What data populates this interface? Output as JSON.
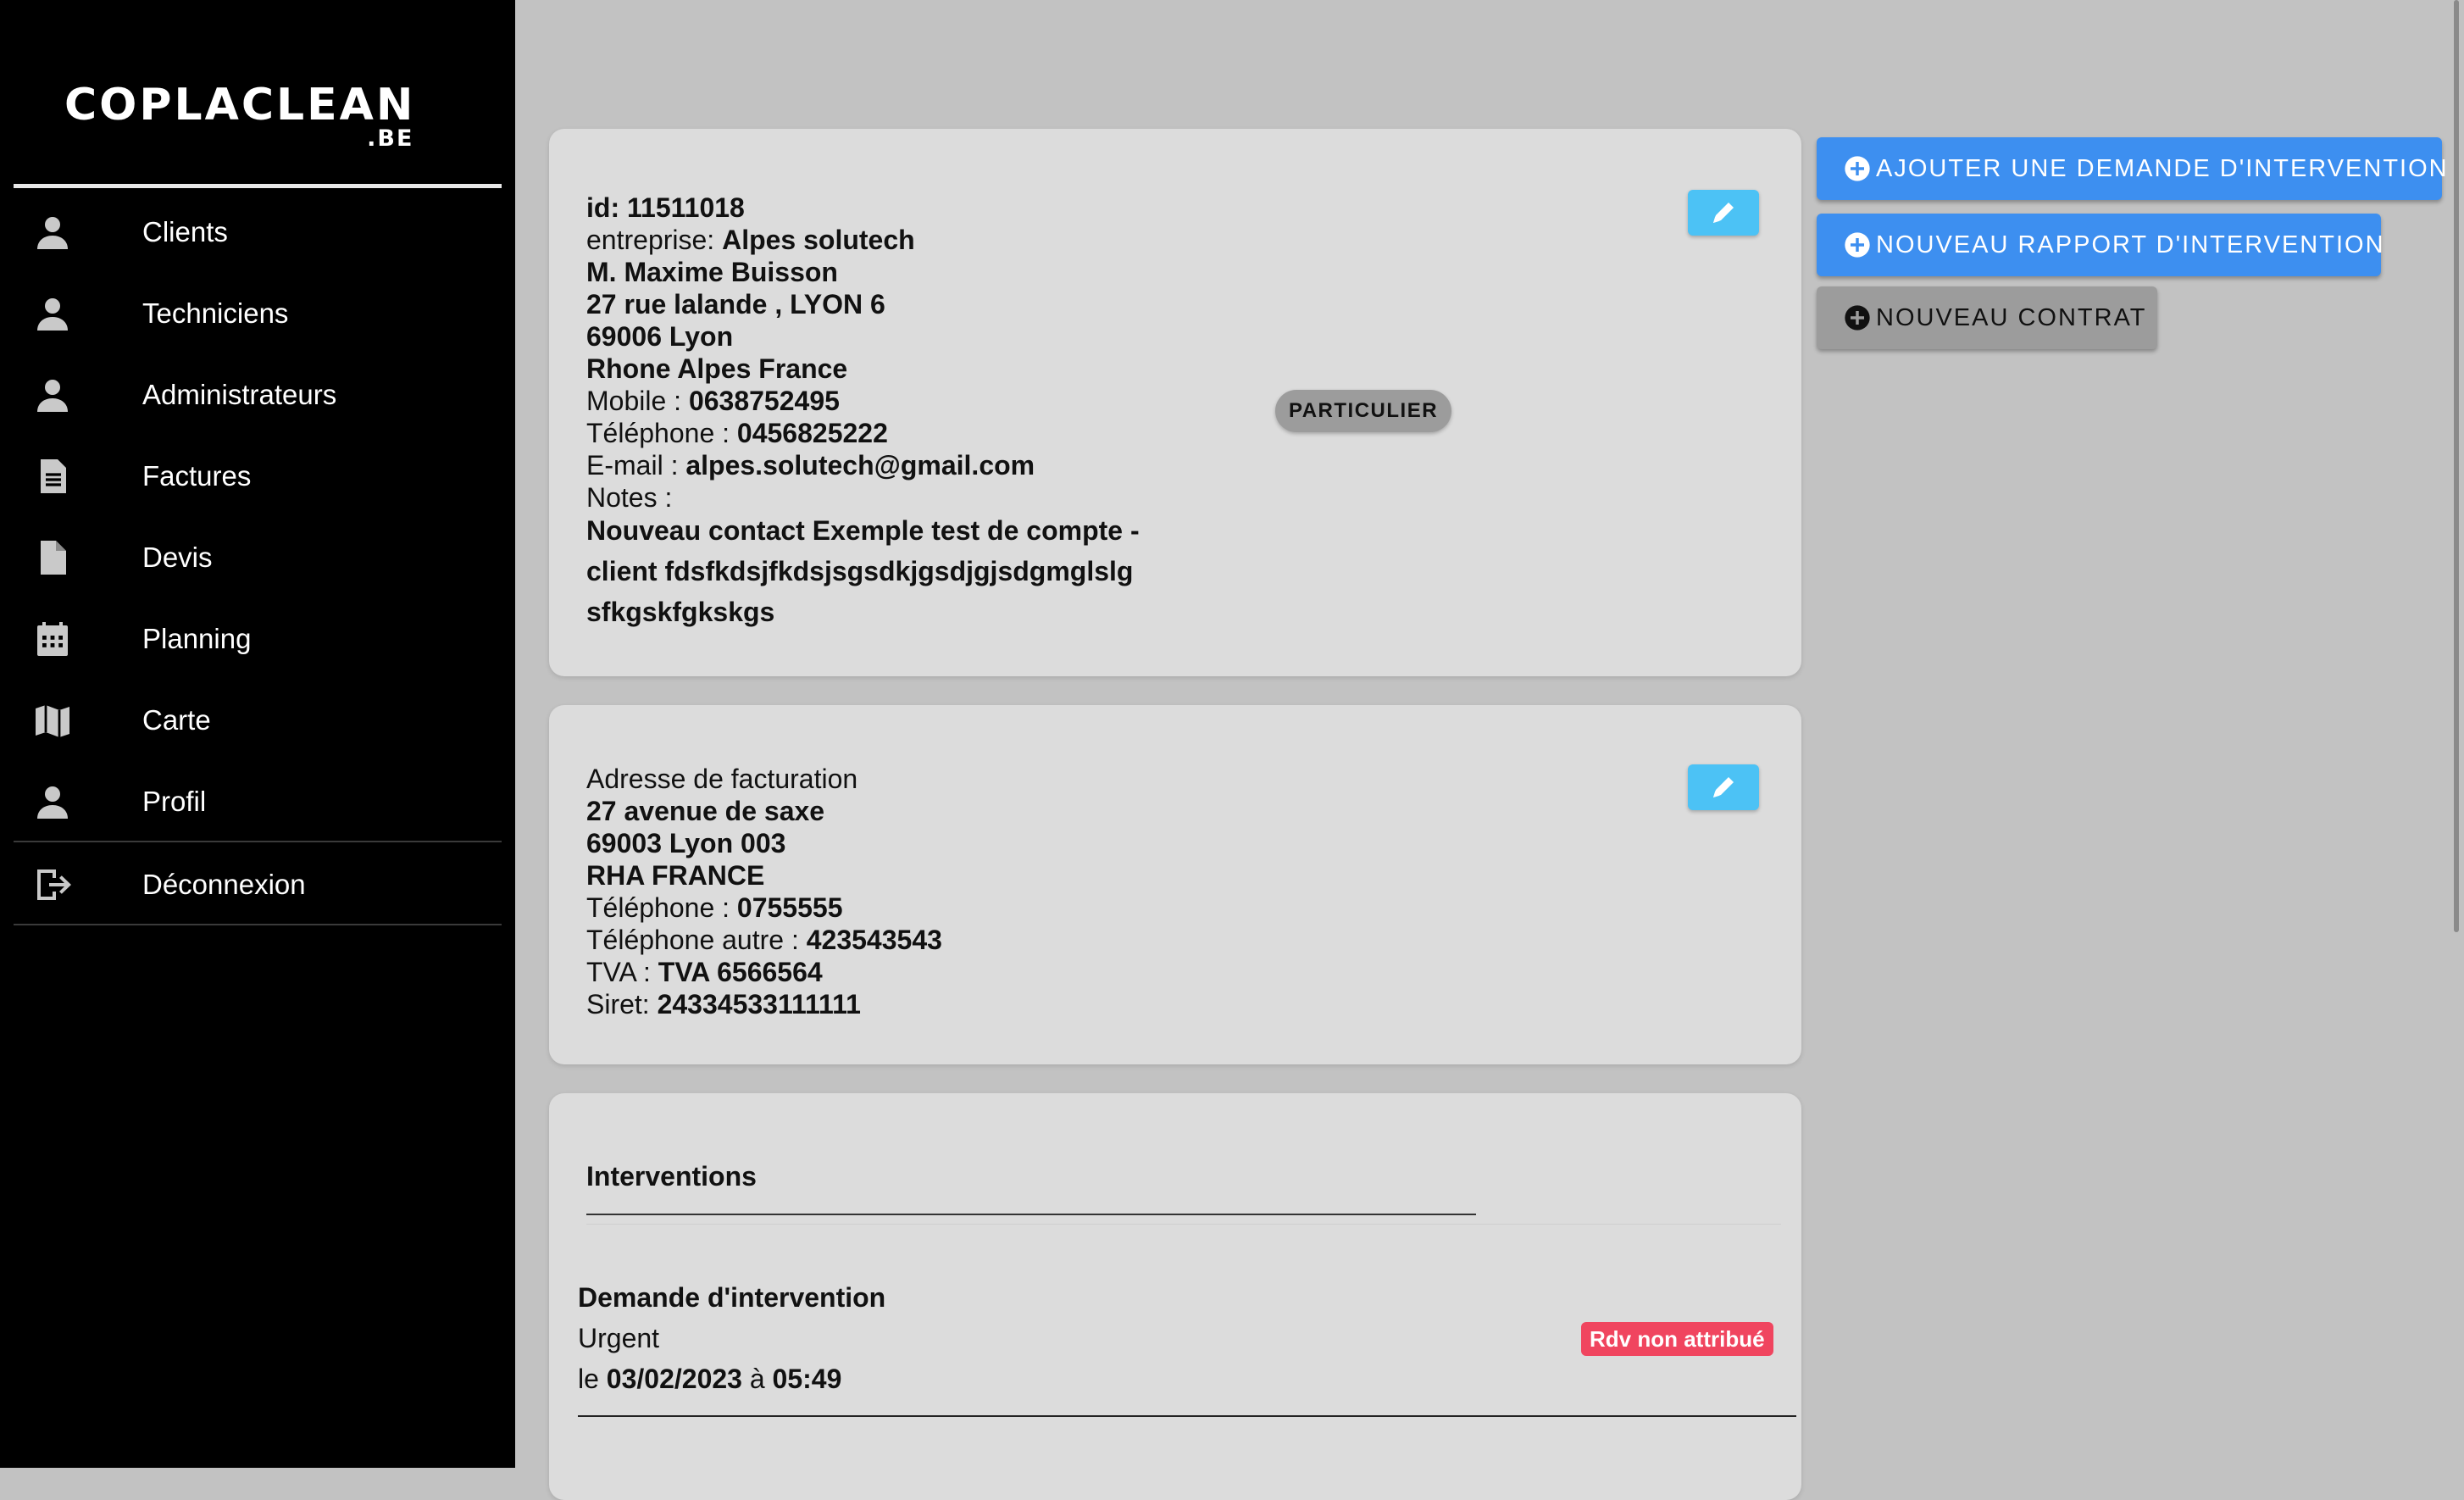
{
  "brand": {
    "name": "COPLACLEAN",
    "suffix": ".BE"
  },
  "nav": {
    "items": [
      {
        "label": "Clients",
        "icon": "person-icon"
      },
      {
        "label": "Techniciens",
        "icon": "person-icon"
      },
      {
        "label": "Administrateurs",
        "icon": "person-icon"
      },
      {
        "label": "Factures",
        "icon": "document-icon"
      },
      {
        "label": "Devis",
        "icon": "file-icon"
      },
      {
        "label": "Planning",
        "icon": "calendar-icon"
      },
      {
        "label": "Carte",
        "icon": "map-icon"
      },
      {
        "label": "Profil",
        "icon": "person-icon"
      }
    ],
    "logout": {
      "label": "Déconnexion",
      "icon": "logout-icon"
    }
  },
  "client": {
    "id_label": "id: ",
    "id": "11511018",
    "company_label": "entreprise: ",
    "company": "Alpes solutech",
    "name": "M. Maxime Buisson",
    "address1": "27 rue lalande , LYON 6",
    "address2": "69006 Lyon",
    "address3": "Rhone Alpes France",
    "mobile_label": "Mobile : ",
    "mobile": "0638752495",
    "phone_label": "Téléphone : ",
    "phone": "0456825222",
    "email_label": "E-mail : ",
    "email": "alpes.solutech@gmail.com",
    "notes_label": "Notes :",
    "notes": "Nouveau contact Exemple test de compte - client fdsfkdsjfkdsjsgsdkjgsdjgjsdgmglslg sfkgskfgkskgs",
    "type_chip": "PARTICULIER"
  },
  "billing": {
    "title": "Adresse de facturation",
    "address1": "27 avenue de saxe",
    "address2": "69003 Lyon 003",
    "address3": "RHA FRANCE",
    "phone_label": "Téléphone : ",
    "phone": "0755555",
    "phone_other_label": "Téléphone autre : ",
    "phone_other": "423543543",
    "tva_label": "TVA : ",
    "tva": "TVA 6566564",
    "siret_label": "Siret: ",
    "siret": "24334533111111"
  },
  "actions": {
    "add_request": "AJOUTER UNE DEMANDE D'INTERVENTION",
    "new_report": "NOUVEAU RAPPORT D'INTERVENTION",
    "new_contract": "NOUVEAU CONTRAT"
  },
  "interventions": {
    "title": "Interventions",
    "items": [
      {
        "title": "Demande d'intervention",
        "priority": "Urgent",
        "date_prefix": "le ",
        "date": "03/02/2023",
        "time_sep": " à ",
        "time": "05:49",
        "status": "Rdv non attribué"
      }
    ]
  },
  "colors": {
    "sidebar": "#000000",
    "accent_blue": "#3d8ff0",
    "edit_blue": "#4cc2f5",
    "badge_red": "#f0455f",
    "card": "#dcdcdc",
    "background": "#c2c2c2"
  }
}
